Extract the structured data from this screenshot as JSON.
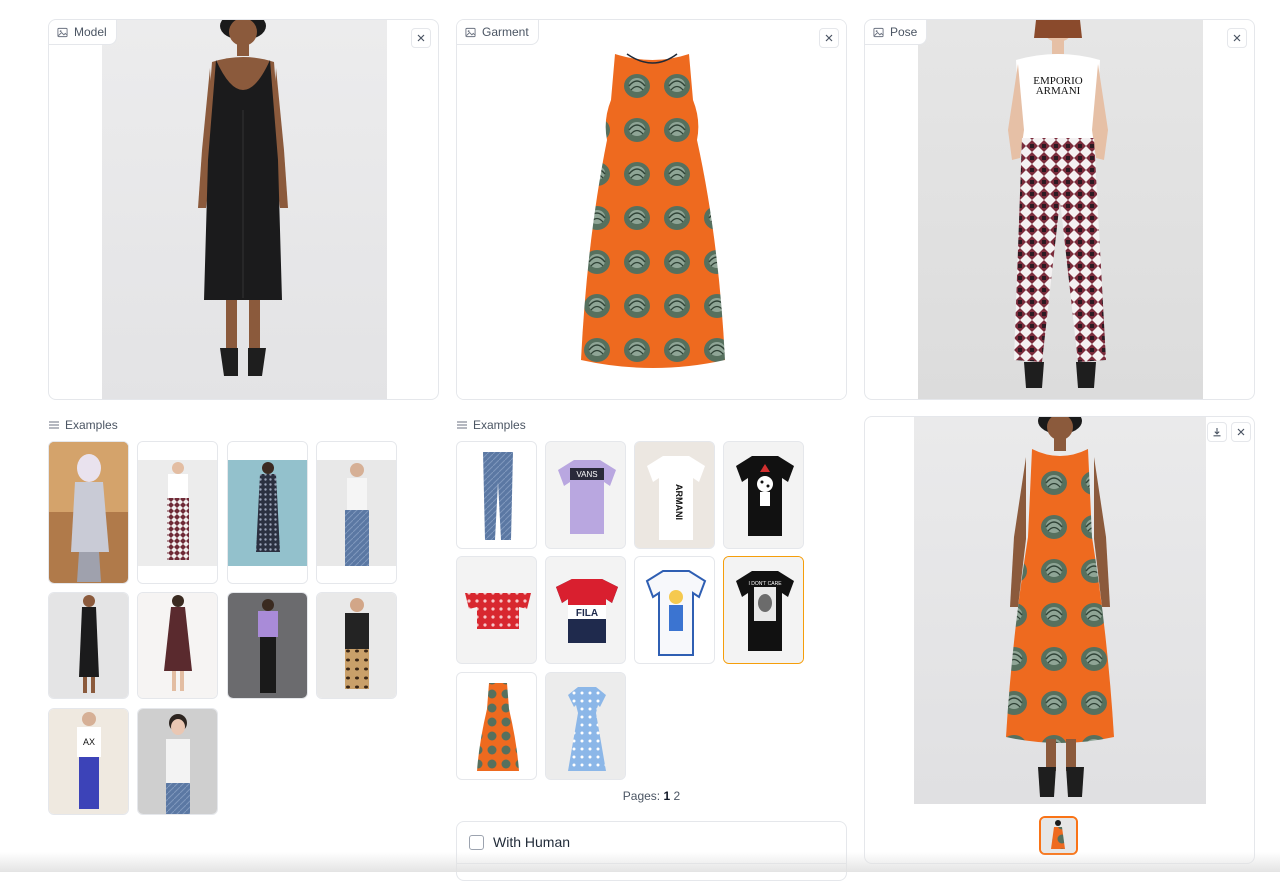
{
  "inputs": {
    "model": {
      "label": "Model",
      "image_icon": "image-icon",
      "clear_icon": "close-icon"
    },
    "garment": {
      "label": "Garment",
      "image_icon": "image-icon",
      "clear_icon": "close-icon"
    },
    "pose": {
      "label": "Pose",
      "image_icon": "image-icon",
      "clear_icon": "close-icon"
    }
  },
  "model_examples": {
    "label": "Examples",
    "icon": "list-icon",
    "items": [
      "fantasy-armor-figure",
      "model-tee-patterned-pants",
      "model-sequin-dress",
      "man-white-tank-jeans",
      "woman-black-slip-dress",
      "woman-brown-dress",
      "woman-lilac-tee-leggings",
      "woman-sheer-top-leopard-skirt",
      "man-white-tee-blue-pants",
      "woman-white-tank-jeans"
    ]
  },
  "garment_examples": {
    "label": "Examples",
    "icon": "list-icon",
    "items": [
      "distressed-jeans",
      "vans-lilac-tee",
      "armani-white-tee",
      "dalmatian-black-tee",
      "red-floral-off-shoulder-top",
      "fila-colorblock-tee",
      "cartoon-ringer-tee",
      "graphic-black-tee",
      "orange-cabbage-dress",
      "blue-floral-midi-dress"
    ],
    "selected_index": 7,
    "pages_label": "Pages:",
    "pages": [
      "1",
      "2"
    ],
    "current_page": "1"
  },
  "options": {
    "with_human_label": "With Human",
    "with_human_checked": false
  },
  "result": {
    "download_icon": "download-icon",
    "clear_icon": "close-icon",
    "thumbnail": "result-thumbnail"
  },
  "artwork_text": {
    "pose_tee_line1": "EMPORIO",
    "pose_tee_line2": "ARMANI",
    "thumb_vans": "VANS",
    "thumb_armani": "ARMANI",
    "thumb_fila": "FILA",
    "thumb_graphic": "I DON'T CARE"
  },
  "colors": {
    "accent": "#f97316",
    "selected_border": "#f59e0b",
    "dress_orange": "#ee6a1f",
    "cabbage_green": "#5f7a66"
  }
}
